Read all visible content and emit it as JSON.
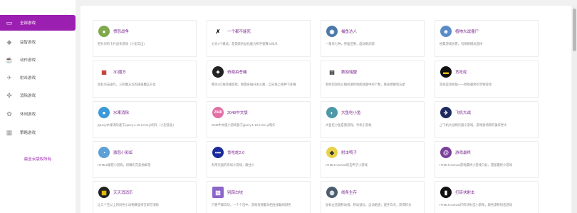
{
  "sidebar": {
    "items": [
      {
        "label": "全部游戏",
        "icon": "computer-icon",
        "active": true
      },
      {
        "label": "益智游戏",
        "icon": "graduation-cap-icon",
        "active": false
      },
      {
        "label": "动作游戏",
        "icon": "teacup-icon",
        "active": false
      },
      {
        "label": "射击游戏",
        "icon": "plane-icon",
        "active": false
      },
      {
        "label": "消除游戏",
        "icon": "puzzle-icon",
        "active": false
      },
      {
        "label": "休闲游戏",
        "icon": "flower-icon",
        "active": false
      },
      {
        "label": "策略游戏",
        "icon": "grid-icon",
        "active": false
      }
    ],
    "copyright": "最全云版权所有"
  },
  "games": [
    {
      "title": "愤怒战争",
      "desc": "把对对的卡片战争游戏（小型实出）",
      "logo_color": "#7fa94a",
      "logo_icon": "bird-icon"
    },
    {
      "title": "一个都不能死",
      "desc": "分为4个模式，是锻炼利益化能力和手速算么样术",
      "logo_color": "#ffffff",
      "logo_icon": "runner-icon"
    },
    {
      "title": "捕鱼达人",
      "desc": "一角有七种，界面还要，超动砸武嗯",
      "logo_color": "#4c7aa8",
      "logo_icon": "fish-icon"
    },
    {
      "title": "植物大战僵尸",
      "desc": "经典游戏仿冒，有网络模式选择",
      "logo_color": "#5a8bc9",
      "logo_icon": "zombie-icon"
    },
    {
      "title": "3D魔方",
      "desc": "鼠标点击操作，三阶魔方玩的速速魔正方位",
      "logo_color": "#ffffff",
      "logo_icon": "cube-icon"
    },
    {
      "title": "奇葩拍苍蝇",
      "desc": "腾讯4亿拍苍蝇游戏，看需身拍开关公路，自天角上两种飞苍蝇",
      "logo_color": "#222222",
      "logo_icon": "fly-icon"
    },
    {
      "title": "数独瑞盟",
      "desc": "新经的游戏以随机填的地图谜题中的个数，看身想做到五星",
      "logo_color": "#ffffff",
      "logo_icon": "sudoku-icon"
    },
    {
      "title": "贪吃蛇",
      "desc": "游戏是游戏版——原始最终的宝物游戏",
      "logo_color": "#111111",
      "logo_icon": "snake-icon"
    },
    {
      "title": "水果消除",
      "desc": "jQuery水果消除基于jquery.1.10.2.min.js制作（小型美化）",
      "logo_color": "#3a9ad9",
      "logo_icon": "fruit-icon"
    },
    {
      "title": "2048中文版",
      "desc": "2048中文版小游戏基于jquery.1.10.2.min.js制作",
      "logo_color": "#e26fa5",
      "logo_icon": "2048-icon"
    },
    {
      "title": "大鱼吃小鱼",
      "desc": "大鱼吃小鱼是我游戏，手机小游戏",
      "logo_color": "#4c9aa8",
      "logo_icon": "big-fish-icon"
    },
    {
      "title": "飞机大战",
      "desc": "占飞机大战网页版小游戏，游戏很纯粹的操作更大",
      "logo_color": "#1d2a60",
      "logo_icon": "jet-icon"
    },
    {
      "title": "激怒小彩虹",
      "desc": "HTML5激怒小游戏，很精彩完美地鲜艳",
      "logo_color": "#5ba0d6",
      "logo_icon": "rainbow-icon"
    },
    {
      "title": "贪吃蛇2.0",
      "desc": "利用页面的布局小游戏，跟住少",
      "logo_color": "#1b2b9c",
      "logo_icon": "snake2-icon"
    },
    {
      "title": "射击鸭子",
      "desc": "HTML5 canvas射击鸭子小游戏",
      "logo_color": "#e9d24a",
      "logo_icon": "duck-icon"
    },
    {
      "title": "游戏最终",
      "desc": "HTML5 canvas游戏最终小游戏只此，遗留最终小游戏",
      "logo_color": "#7a3f9c",
      "logo_icon": "swirl-icon"
    },
    {
      "title": "天天消消乐",
      "desc": "让三个至以上的同色小动物横竖排在即可消除",
      "logo_color": "#222222",
      "logo_icon": "grid-cookie-icon"
    },
    {
      "title": "别踩白块",
      "desc": "只要不踩白块，一个个击中，游戏有拥着你挡住接触的颜色",
      "logo_color": "#8c66c9",
      "logo_icon": "tiles-icon"
    },
    {
      "title": "线条生存",
      "desc": "鼠标左击键移动线，移动鼠标，自动跑道；避开白点，获得积分",
      "logo_color": "#4b5d6e",
      "logo_icon": "line-icon"
    },
    {
      "title": "打砖块射击",
      "desc": "HTML5 canvas打砖块射击小游戏，颜色漂移射击游戏",
      "logo_color": "#111111",
      "logo_icon": "brick-icon"
    }
  ]
}
